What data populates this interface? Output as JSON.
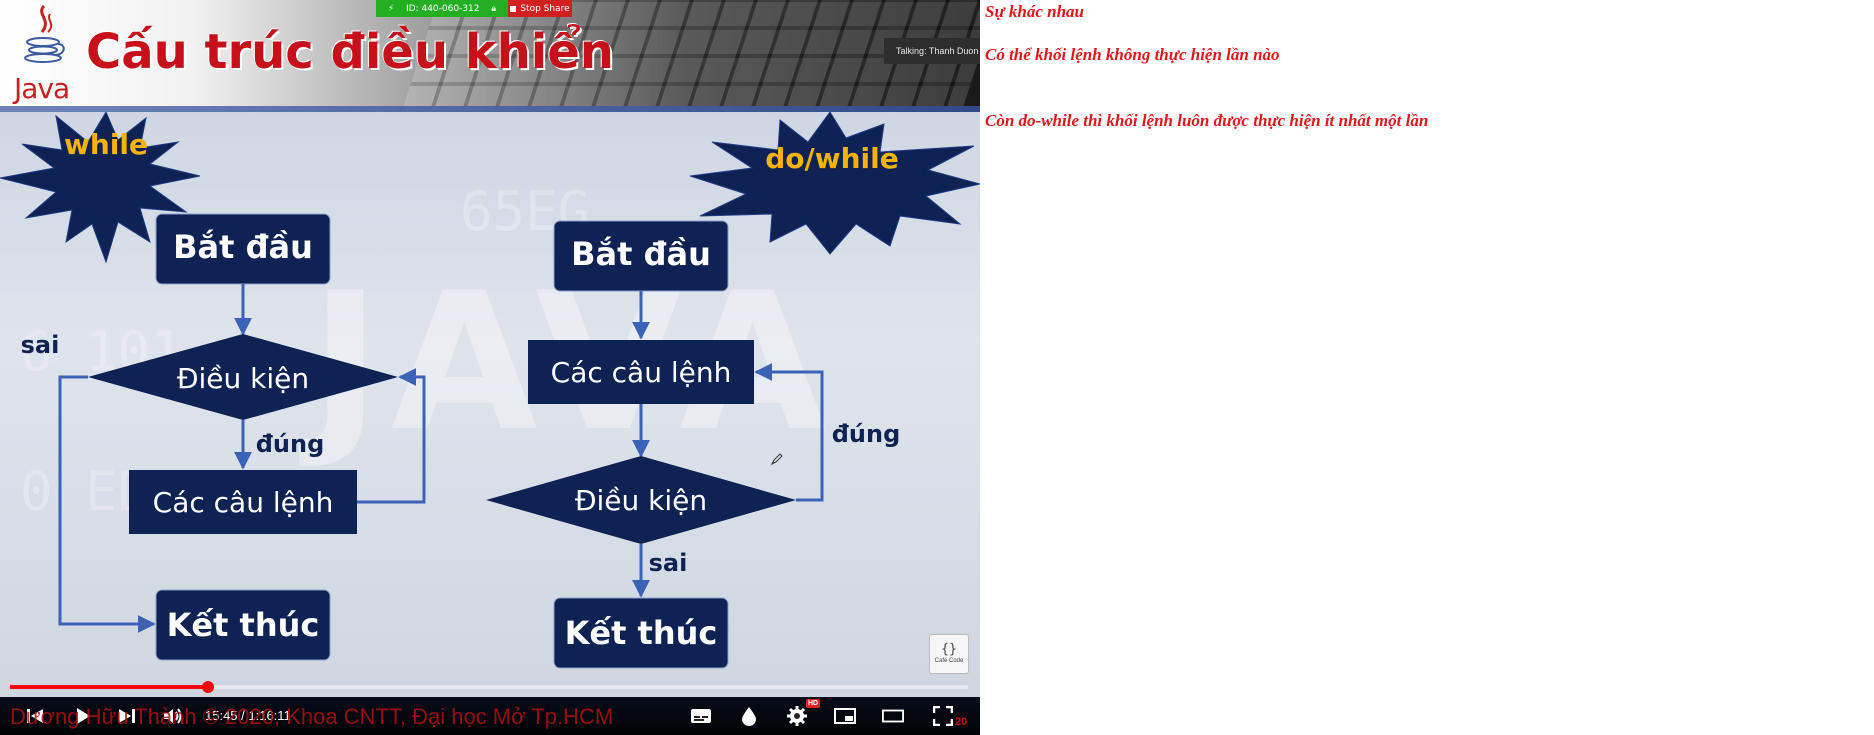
{
  "slide": {
    "title": "Cấu trúc điều khiển",
    "java_logo_text": "Java",
    "while_label": "while",
    "dowhile_label": "do/while",
    "left_flow": {
      "start": "Bắt đầu",
      "condition": "Điều kiện",
      "statements": "Các câu lệnh",
      "end": "Kết thúc",
      "true_label": "đúng",
      "false_label": "sai"
    },
    "right_flow": {
      "start": "Bắt đầu",
      "statements": "Các câu lệnh",
      "condition": "Điều kiện",
      "end": "Kết thúc",
      "true_label": "đúng",
      "false_label": "sai"
    },
    "background_text": "JAVA",
    "background_numbers": [
      "65EG",
      "6 101",
      "0 ED"
    ],
    "corner_logo_text": "Café Code"
  },
  "zoom": {
    "meeting_id": "ID: 440-060-312",
    "stop_share": "Stop Share",
    "talking": "Talking: Thanh Duon"
  },
  "player": {
    "time": "15:45 / 1:16:11",
    "progress_fraction": 0.2067,
    "caption": "Dương Hữu Thành © 2020, Khoa CNTT, Đại học Mở Tp.HCM",
    "hd_badge": "HD",
    "tiny_number": "20"
  },
  "notes": [
    "Sự khác nhau",
    "Có thể khối lệnh không thực hiện lần nào",
    "Còn do-while thì khối lệnh luôn được thực hiện ít nhất một lần"
  ],
  "colors": {
    "box_fill": "#0f2254",
    "arrow": "#3a63b8",
    "star_fill": "#0f2254",
    "star_text": "#f5b400",
    "label_text": "#0f2254",
    "note_text": "#e4161c",
    "title_red": "#c8101a"
  }
}
